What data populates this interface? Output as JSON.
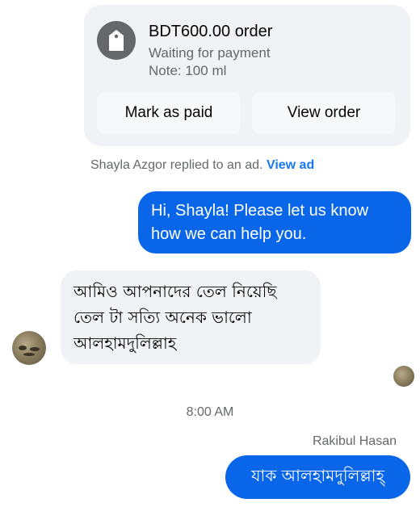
{
  "order": {
    "title": "BDT600.00 order",
    "status": "Waiting for payment",
    "note": "Note: 100 ml",
    "mark_paid_label": "Mark as paid",
    "view_order_label": "View order",
    "icon": "price-tag-icon"
  },
  "reply_notice": {
    "text": "Shayla Azgor replied to an ad.",
    "link_label": "View ad"
  },
  "messages": [
    {
      "direction": "outgoing",
      "text": "Hi, Shayla! Please let us know how we can help you."
    },
    {
      "direction": "incoming",
      "lines": [
        "আমিও আপনাদের তেল নিয়েছি",
        "তেল টা সত্যি অনেক ভালো",
        "আলহামদুলিল্লাহ"
      ]
    },
    {
      "direction": "outgoing",
      "text": "যাক আলহামদুলিল্লাহ্"
    }
  ],
  "timestamp": "8:00 AM",
  "sender_name": "Rakibul Hasan",
  "colors": {
    "outgoing_bubble": "#0a66e8",
    "incoming_bubble": "#f0f2f5",
    "link": "#1877f2"
  }
}
